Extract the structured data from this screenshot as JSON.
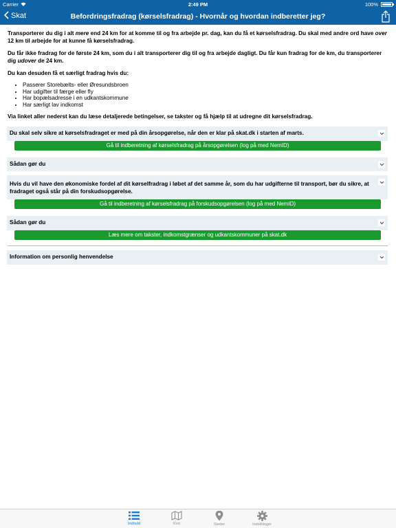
{
  "statusbar": {
    "carrier": "Carrier",
    "time": "2:49 PM",
    "battery": "100%"
  },
  "navbar": {
    "back_label": "Skat",
    "title": "Befordringsfradrag (kørselsfradrag) - Hvornår og hvordan indberetter jeg?"
  },
  "content": {
    "p1_a": "Transporterer du dig i alt ",
    "p1_em1": "mere",
    "p1_b": " end 24 km for at komme til og fra arbejde pr. dag, kan du få et kørselsfradrag. Du skal med andre ord have ",
    "p1_em2": "over",
    "p1_c": " 12 km til arbejde for at kunne få kørselsfradrag.",
    "p2_a": "Du får ikke fradrag for de første 24 km, som du i alt transporterer dig til og fra arbejde dagligt. Du får kun fradrag for de km, du transporterer dig ",
    "p2_em": "udover",
    "p2_b": " de 24 km.",
    "p3": "Du kan desuden få et særligt fradrag hvis du:",
    "bullets": [
      "Passerer Storebælts- eller Øresundsbroen",
      "Har udgifter til færge eller fly",
      "Har bopælsadresse i en udkantskommune",
      "Har særligt lav indkomst"
    ],
    "p4": "Via linket aller nederst kan du læse detaljerede betingelser, se takster og få hjælp til at udregne dit kørselsfradrag."
  },
  "sections": [
    {
      "heading": "Du skal selv sikre at kørselsfradraget er med på din årsopgørelse, når den er klar på skat.dk i starten af marts.",
      "button": "Gå til indberetning af kørselsfradrag på årsopgørelsen (log på med NemID)"
    },
    {
      "heading": "Sådan gør du"
    },
    {
      "heading": "Hvis du vil have den økonomiske fordel af dit kørselfradrag i løbet af det samme år, som du har udgifterne til transport, bør du sikre, at fradraget også står på din forskudsopgørelse.",
      "button": "Gå til indberetning af kørselsfradrag på forskudsopgørelsen (log på med NemID)"
    },
    {
      "heading": "Sådan gør du",
      "button": "Læs mere om takster, indkomstgrænser og udkantskommuner på skat.dk"
    },
    {
      "heading": "Information om personlig henvendelse"
    }
  ],
  "tabs": [
    {
      "label": "Indhold",
      "icon": "list-icon",
      "active": true
    },
    {
      "label": "Kort",
      "icon": "map-icon"
    },
    {
      "label": "Steder",
      "icon": "location-pin-icon"
    },
    {
      "label": "Indstillinger",
      "icon": "gear-icon"
    }
  ],
  "colors": {
    "nav": "#0f62a6",
    "button": "#1a9a2e",
    "section_bg": "#e8f0f4",
    "tab_active": "#1a78d2"
  }
}
